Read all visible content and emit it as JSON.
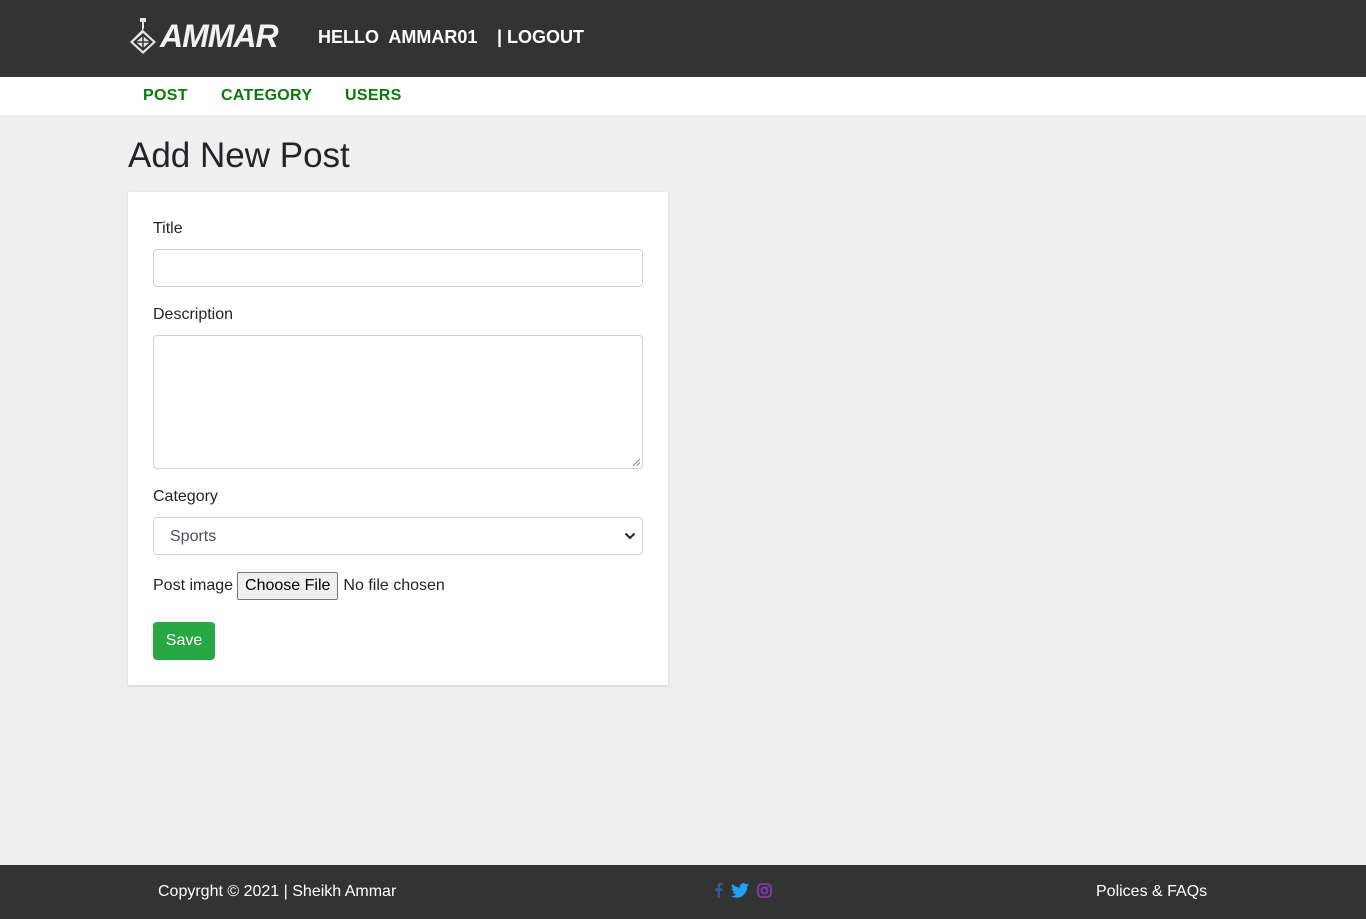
{
  "header": {
    "logo_text": "AMMAR",
    "greeting": "HELLO  AMMAR01",
    "logout_label": "| LOGOUT"
  },
  "menu": {
    "items": [
      {
        "label": "POST"
      },
      {
        "label": "CATEGORY"
      },
      {
        "label": "USERS"
      }
    ]
  },
  "page": {
    "title": "Add New Post"
  },
  "form": {
    "title_label": "Title",
    "title_value": "",
    "description_label": "Description",
    "description_value": "",
    "category_label": "Category",
    "category_selected": "Sports",
    "image_label": "Post image",
    "file_button": "Choose File",
    "file_status": "No file chosen",
    "save_label": "Save"
  },
  "footer": {
    "copyright": "Copyrght © 2021 | Sheikh Ammar",
    "social": [
      {
        "icon": "facebook-icon",
        "color": "#3b5998"
      },
      {
        "icon": "twitter-icon",
        "color": "#1da1f2"
      },
      {
        "icon": "instagram-icon",
        "color": "#8a3ab9"
      }
    ],
    "policies_label": "Polices & FAQs"
  },
  "colors": {
    "header_bg": "#333333",
    "menu_link": "#0a7a0a",
    "save_button": "#28a745",
    "page_bg": "#efefef"
  }
}
